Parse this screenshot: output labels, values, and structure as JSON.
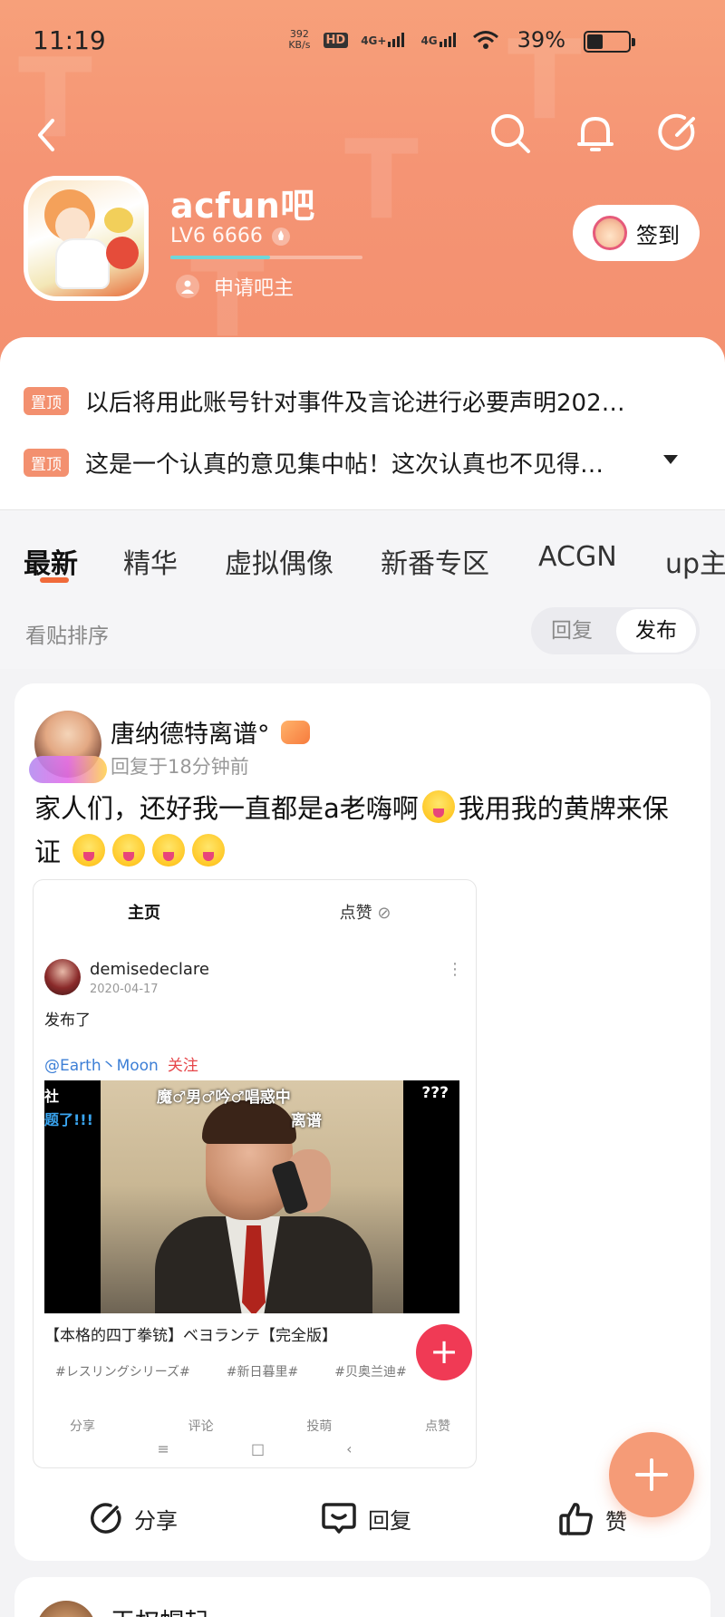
{
  "status_bar": {
    "time": "11:19",
    "net_speed_value": "392",
    "net_speed_unit": "KB/s",
    "hd_label": "HD",
    "sim1_label": "4G+",
    "sim2_label": "4G",
    "battery_percent": "39%",
    "battery_level": 0.39
  },
  "forum": {
    "name": "acfun吧",
    "level": "LV6 6666",
    "level_progress": 0.52,
    "apply_admin": "申请吧主",
    "sign_in": "签到"
  },
  "pinned": [
    {
      "tag": "置顶",
      "text": "以后将用此账号针对事件及言论进行必要声明202…"
    },
    {
      "tag": "置顶",
      "text": "这是一个认真的意见集中帖！这次认真也不见得…"
    }
  ],
  "tabs": [
    "最新",
    "精华",
    "虚拟偶像",
    "新番专区",
    "ACGN",
    "up主"
  ],
  "sort": {
    "label": "看贴排序",
    "options": [
      "回复",
      "发布"
    ],
    "selected": "发布"
  },
  "post": {
    "author": "唐纳德特离谱°",
    "time": "回复于18分钟前",
    "text_part1": "家人们，还好我一直都是a老嗨啊",
    "text_part2": "我用我的黄牌来保证",
    "screenshot": {
      "tab_main": "主页",
      "tab_likes": "点赞",
      "user": "demisedeclare",
      "date": "2020-04-17",
      "body": "发布了",
      "mention": "@Earth丶Moon",
      "follow": "关注",
      "video_caption1": "魔♂男♂吟♂唱惑中",
      "video_caption2": "离谱",
      "video_caption3": "???",
      "video_left1": "社",
      "video_left2": "题了!!!",
      "title": "【本格的四丁拳铳】ベヨランテ【完全版】",
      "tags": [
        "#レスリングシリーズ#",
        "#新日暮里#",
        "#贝奥兰迪#"
      ],
      "actions": [
        "分享",
        "评论",
        "投萌",
        "点赞"
      ],
      "fab": "+"
    },
    "actions": {
      "share": "分享",
      "reply": "回复",
      "like": "赞"
    }
  },
  "next_post": {
    "author": "王权帽起"
  },
  "fab_label": "+",
  "colors": {
    "accent": "#f3906f",
    "orange_line": "#f06a3a",
    "link": "#3d7fd6"
  }
}
